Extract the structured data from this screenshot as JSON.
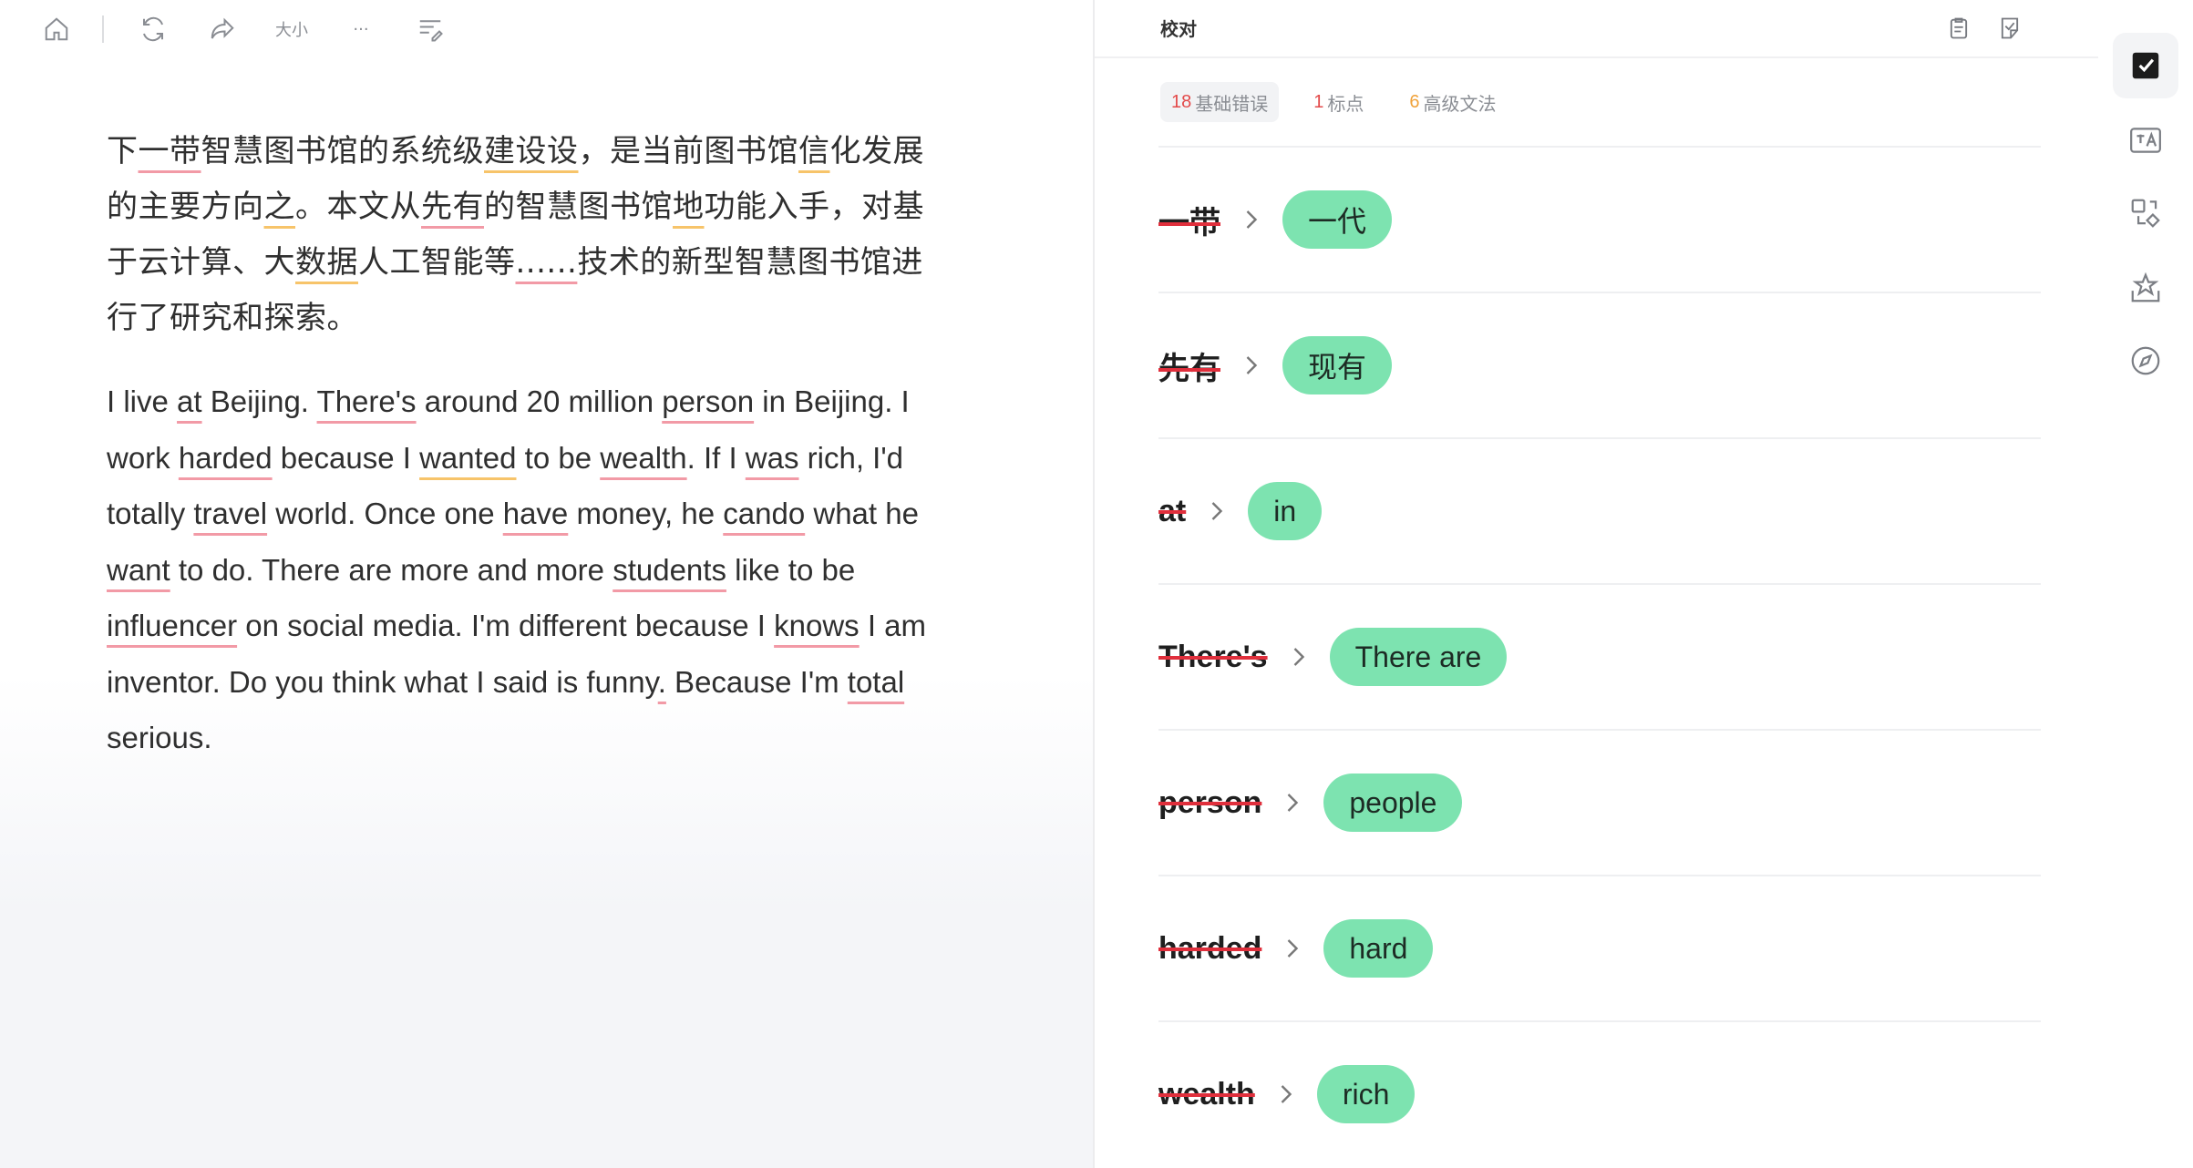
{
  "toolbar": {
    "icons": [
      "home-icon",
      "refresh-icon",
      "share-icon",
      "font-size-icon",
      "more-icon",
      "format-icon"
    ],
    "font_size_label": "大小",
    "more_label": "···"
  },
  "document": {
    "zh_segments": [
      {
        "t": "下",
        "u": ""
      },
      {
        "t": "一带",
        "u": "red"
      },
      {
        "t": "智慧图书馆的系统级",
        "u": ""
      },
      {
        "t": "建设设",
        "u": "yel"
      },
      {
        "t": "，是当前图书馆",
        "u": ""
      },
      {
        "t": "信",
        "u": "yel"
      },
      {
        "t": "化发展的主要方向",
        "u": ""
      },
      {
        "t": "之",
        "u": "yel"
      },
      {
        "t": "。本文从",
        "u": ""
      },
      {
        "t": "先有",
        "u": "red"
      },
      {
        "t": "的智慧图书馆",
        "u": ""
      },
      {
        "t": "地",
        "u": "yel"
      },
      {
        "t": "功能入手，对基于云计算、大",
        "u": ""
      },
      {
        "t": "数据",
        "u": "yel"
      },
      {
        "t": "人工智能等",
        "u": ""
      },
      {
        "t": "......",
        "u": "red"
      },
      {
        "t": "技术的新型智慧图书馆进行了研究和探索。",
        "u": ""
      }
    ],
    "en_segments": [
      {
        "t": "I live ",
        "u": ""
      },
      {
        "t": "at",
        "u": "red"
      },
      {
        "t": " Beijing. ",
        "u": ""
      },
      {
        "t": "There's",
        "u": "red"
      },
      {
        "t": " around 20 million ",
        "u": ""
      },
      {
        "t": "person",
        "u": "red"
      },
      {
        "t": " in Beijing. I work ",
        "u": ""
      },
      {
        "t": "harded",
        "u": "red"
      },
      {
        "t": " because I ",
        "u": ""
      },
      {
        "t": "wanted",
        "u": "yel"
      },
      {
        "t": " to be ",
        "u": ""
      },
      {
        "t": "wealth",
        "u": "red"
      },
      {
        "t": ". If I ",
        "u": ""
      },
      {
        "t": "was",
        "u": "red"
      },
      {
        "t": " rich, I'd totally ",
        "u": ""
      },
      {
        "t": "travel",
        "u": "red"
      },
      {
        "t": " world. Once one ",
        "u": ""
      },
      {
        "t": "have",
        "u": "red"
      },
      {
        "t": " money, he ",
        "u": ""
      },
      {
        "t": "cando",
        "u": "red"
      },
      {
        "t": " what he ",
        "u": ""
      },
      {
        "t": "want",
        "u": "red"
      },
      {
        "t": " to do. There are more and more ",
        "u": ""
      },
      {
        "t": "students",
        "u": "red"
      },
      {
        "t": " like to be ",
        "u": ""
      },
      {
        "t": "influencer",
        "u": "red"
      },
      {
        "t": " on social media. I'm different because I ",
        "u": ""
      },
      {
        "t": "knows",
        "u": "red"
      },
      {
        "t": " I am inventor. Do you think what I said is funny",
        "u": ""
      },
      {
        "t": ".",
        "u": "red"
      },
      {
        "t": " Because I'm ",
        "u": ""
      },
      {
        "t": "total",
        "u": "red"
      },
      {
        "t": " serious.",
        "u": ""
      }
    ]
  },
  "panel": {
    "title": "校对",
    "header_icons": [
      "clipboard-icon",
      "check-note-icon"
    ],
    "tabs": [
      {
        "count": "18",
        "label": "基础错误",
        "color": "#e34a4a",
        "active": true
      },
      {
        "count": "1",
        "label": "标点",
        "color": "#e34a4a",
        "active": false
      },
      {
        "count": "6",
        "label": "高级文法",
        "color": "#f0a23a",
        "active": false
      }
    ],
    "corrections": [
      {
        "wrong": "一带",
        "fix": "一代",
        "zh": true
      },
      {
        "wrong": "先有",
        "fix": "现有",
        "zh": true
      },
      {
        "wrong": "at",
        "fix": "in",
        "zh": false
      },
      {
        "wrong": "There's",
        "fix": "There are",
        "zh": false
      },
      {
        "wrong": "person",
        "fix": "people",
        "zh": false
      },
      {
        "wrong": "harded",
        "fix": "hard",
        "zh": false
      },
      {
        "wrong": "wealth",
        "fix": "rich",
        "zh": false
      }
    ]
  },
  "rail": {
    "icons": [
      "proofread-icon",
      "translate-icon",
      "convert-icon",
      "favorite-box-icon",
      "compass-icon"
    ]
  }
}
